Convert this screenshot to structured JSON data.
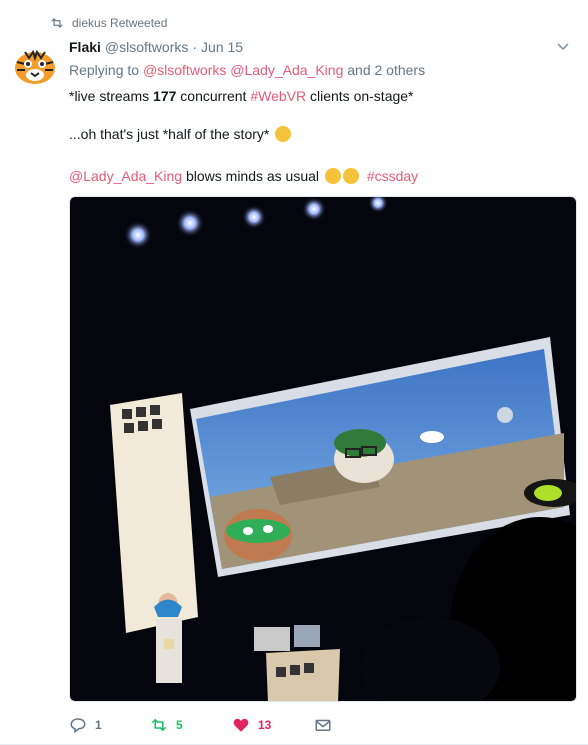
{
  "retweet_context": {
    "text": "diekus Retweeted"
  },
  "author": {
    "name": "Flaki",
    "handle": "@slsoftworks",
    "date": "Jun 15"
  },
  "replying": {
    "prefix": "Replying to ",
    "user1": "@slsoftworks",
    "user2": "@Lady_Ada_King",
    "suffix": " and 2 others"
  },
  "body": {
    "line1_pre": "*live streams ",
    "line1_num": "177",
    "line1_mid": " concurrent ",
    "line1_tag": "#WebVR",
    "line1_post": " clients on-stage*",
    "line2": "...oh that's just *half of the story*",
    "line3_mention": "@Lady_Ada_King",
    "line3_mid": " blows minds as usual ",
    "line3_tag": "#cssday"
  },
  "actions": {
    "replies": "1",
    "retweets": "5",
    "likes": "13"
  },
  "colors": {
    "link": "#e65b78",
    "retweet_green": "#17bf63",
    "like_red": "#e0245e",
    "icon_grey": "#657786"
  },
  "icons": [
    "retweet-icon",
    "caret-down-icon",
    "reply-icon",
    "retweet-icon",
    "heart-icon",
    "envelope-icon"
  ]
}
